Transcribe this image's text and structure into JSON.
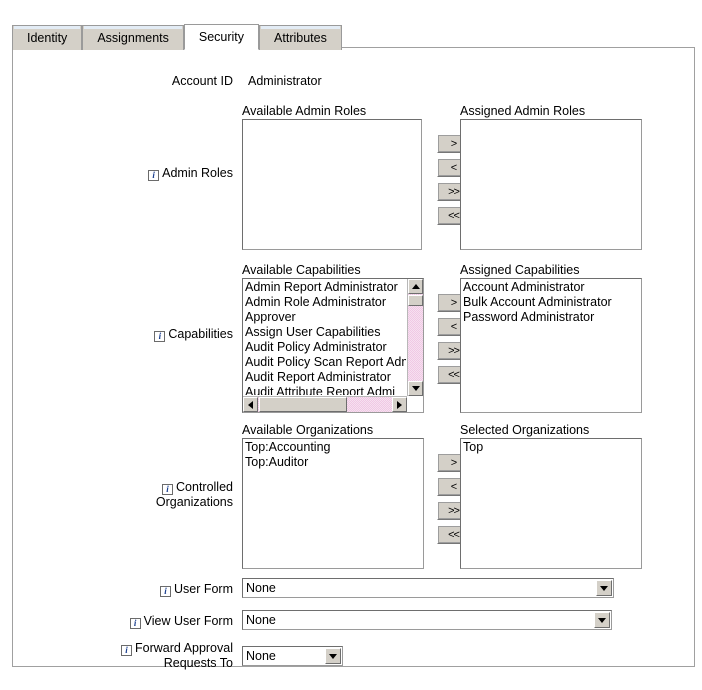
{
  "tabs": [
    {
      "label": "Identity",
      "active": false
    },
    {
      "label": "Assignments",
      "active": false
    },
    {
      "label": "Security",
      "active": true
    },
    {
      "label": "Attributes",
      "active": false
    }
  ],
  "account": {
    "label": "Account ID",
    "value": "Administrator"
  },
  "transfer_buttons": {
    "add": ">",
    "remove": "<",
    "add_all": ">>",
    "remove_all": "<<"
  },
  "admin_roles": {
    "label": "Admin Roles",
    "available_caption": "Available Admin Roles",
    "assigned_caption": "Assigned Admin Roles",
    "available": [],
    "assigned": []
  },
  "capabilities": {
    "label": "Capabilities",
    "available_caption": "Available Capabilities",
    "assigned_caption": "Assigned Capabilities",
    "available": [
      "Admin Report Administrator",
      "Admin Role Administrator",
      "Approver",
      "Assign User Capabilities",
      "Audit Policy Administrator",
      "Audit Policy Scan Report Adm",
      "Audit Report Administrator",
      "Audit Attribute Report Admi"
    ],
    "assigned": [
      "Account Administrator",
      "Bulk Account Administrator",
      "Password Administrator"
    ]
  },
  "organizations": {
    "label_line1": "Controlled",
    "label_line2": "Organizations",
    "available_caption": "Available Organizations",
    "selected_caption": "Selected Organizations",
    "available": [
      "Top:Accounting",
      "Top:Auditor"
    ],
    "selected": [
      "Top"
    ]
  },
  "forms": {
    "user_form": {
      "label": "User Form",
      "value": "None"
    },
    "view_user_form": {
      "label": "View User Form",
      "value": "None"
    },
    "forward_approval": {
      "label_line1": "Forward Approval",
      "label_line2": "Requests To",
      "value": "None"
    }
  },
  "icons": {
    "info": "i",
    "dropdown": "chevron-down-icon",
    "scroll_up": "scroll-up-icon",
    "scroll_down": "scroll-down-icon",
    "scroll_left": "scroll-left-icon",
    "scroll_right": "scroll-right-icon"
  },
  "colors": {
    "tab_inactive": "#d4d0c8",
    "tab_active": "#ffffff",
    "panel_border": "#a0a0a0",
    "info_icon_text": "#1b3f8f",
    "scroll_track": "#f0c8e4"
  }
}
